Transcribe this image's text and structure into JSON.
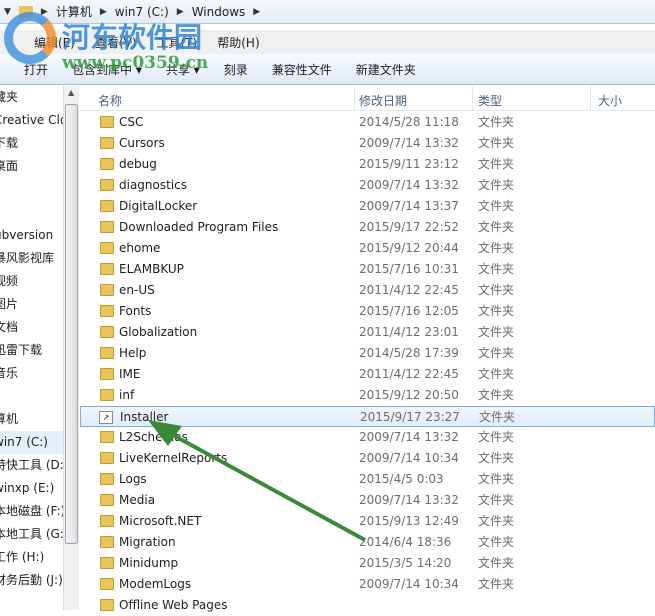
{
  "breadcrumb": [
    "计算机",
    "win7 (C:)",
    "Windows"
  ],
  "menu": [
    "编辑(E)",
    "查看(V)",
    "工具(T)",
    "帮助(H)"
  ],
  "toolbar": [
    "打开",
    "包含到库中 ▾",
    "共享 ▾",
    "刻录",
    "兼容性文件",
    "新建文件夹"
  ],
  "watermark": {
    "name": "河东软件园",
    "url": "www.pc0359.cn"
  },
  "sidebar": [
    "藏夹",
    "Creative Clo",
    "下载",
    "桌面",
    "",
    "",
    "ubversion",
    "暴风影视库",
    "视频",
    "图片",
    "文档",
    "迅雷下载",
    "音乐",
    "",
    "算机",
    "win7 (C:)",
    "特快工具 (D:",
    "winxp (E:)",
    "本地磁盘 (F:)",
    "本地工具 (G:",
    "工作 (H:)",
    "财务后勤 (J:)"
  ],
  "columns": {
    "name": "名称",
    "date": "修改日期",
    "type": "类型",
    "size": "大小"
  },
  "files": [
    {
      "name": "CSC",
      "date": "2014/5/28 11:18",
      "type": "文件夹"
    },
    {
      "name": "Cursors",
      "date": "2009/7/14 13:32",
      "type": "文件夹"
    },
    {
      "name": "debug",
      "date": "2015/9/11 23:12",
      "type": "文件夹"
    },
    {
      "name": "diagnostics",
      "date": "2009/7/14 13:32",
      "type": "文件夹"
    },
    {
      "name": "DigitalLocker",
      "date": "2009/7/14 13:37",
      "type": "文件夹"
    },
    {
      "name": "Downloaded Program Files",
      "date": "2015/9/17 22:52",
      "type": "文件夹"
    },
    {
      "name": "ehome",
      "date": "2015/9/12 20:44",
      "type": "文件夹"
    },
    {
      "name": "ELAMBKUP",
      "date": "2015/7/16 10:31",
      "type": "文件夹"
    },
    {
      "name": "en-US",
      "date": "2011/4/12 22:45",
      "type": "文件夹"
    },
    {
      "name": "Fonts",
      "date": "2015/7/16 12:05",
      "type": "文件夹"
    },
    {
      "name": "Globalization",
      "date": "2011/4/12 23:01",
      "type": "文件夹"
    },
    {
      "name": "Help",
      "date": "2014/5/28 17:39",
      "type": "文件夹"
    },
    {
      "name": "IME",
      "date": "2011/4/12 22:45",
      "type": "文件夹"
    },
    {
      "name": "inf",
      "date": "2015/9/12 20:50",
      "type": "文件夹"
    },
    {
      "name": "Installer",
      "date": "2015/9/17 23:27",
      "type": "文件夹",
      "selected": true
    },
    {
      "name": "L2Schemas",
      "date": "2009/7/14 13:32",
      "type": "文件夹"
    },
    {
      "name": "LiveKernelReports",
      "date": "2009/7/14 10:34",
      "type": "文件夹"
    },
    {
      "name": "Logs",
      "date": "2015/4/5 0:03",
      "type": "文件夹"
    },
    {
      "name": "Media",
      "date": "2009/7/14 13:32",
      "type": "文件夹"
    },
    {
      "name": "Microsoft.NET",
      "date": "2015/9/13 12:49",
      "type": "文件夹"
    },
    {
      "name": "Migration",
      "date": "2014/6/4 18:36",
      "type": "文件夹"
    },
    {
      "name": "Minidump",
      "date": "2015/3/5 14:20",
      "type": "文件夹"
    },
    {
      "name": "ModemLogs",
      "date": "2009/7/14 10:34",
      "type": "文件夹"
    },
    {
      "name": "Offline Web Pages",
      "date": "",
      "type": ""
    }
  ],
  "colors": {
    "arrow": "#3a8a3a",
    "selection": "#84acdd"
  }
}
